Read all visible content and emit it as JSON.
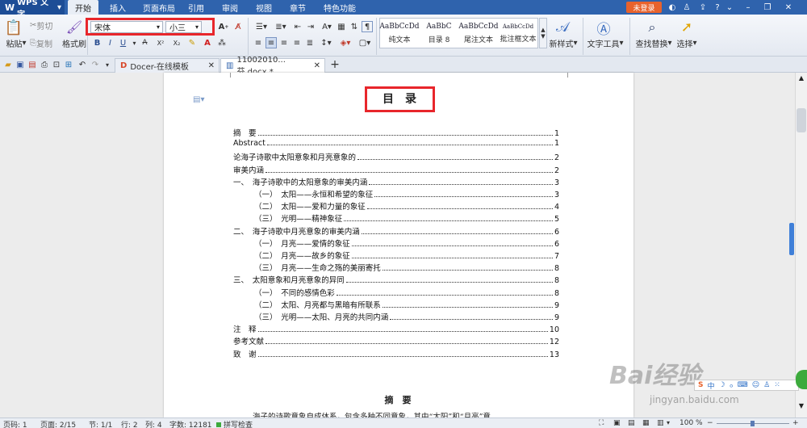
{
  "app": {
    "name": "WPS 文字"
  },
  "menu": {
    "tabs": [
      "开始",
      "插入",
      "页面布局",
      "引用",
      "审阅",
      "视图",
      "章节",
      "特色功能"
    ],
    "login_label": "未登录",
    "active_tab": "开始"
  },
  "ribbon": {
    "paste_label": "粘贴",
    "cut_label": "剪切",
    "copy_label": "复制",
    "format_painter_label": "格式刷",
    "font_name": "宋体",
    "font_size": "小三",
    "styles": [
      {
        "sample": "AaBbCcDd",
        "label": "纯文本"
      },
      {
        "sample": "AaBbC",
        "label": "目录 8"
      },
      {
        "sample": "AaBbCcDd",
        "label": "尾注文本"
      },
      {
        "sample": "AaBbCcDd",
        "label": "批注框文本"
      }
    ],
    "new_style_label": "新样式",
    "text_tools_label": "文字工具",
    "find_replace_label": "查找替换",
    "select_label": "选择"
  },
  "tabs": {
    "docer": "Docer-在线模板",
    "document": "11002010...芬.docx *",
    "add": "+"
  },
  "document": {
    "title": "目　录",
    "toc": [
      {
        "text": "摘　要",
        "page": "1",
        "indent": 0
      },
      {
        "text": "Abstract",
        "page": "1",
        "indent": 0
      },
      {
        "text": "论海子诗歌中太阳意象和月亮意象的",
        "page": "2",
        "indent": 0
      },
      {
        "text": "审美内涵",
        "page": "2",
        "indent": 0
      },
      {
        "text": "一、　海子诗歌中的太阳意象的审美内涵",
        "page": "3",
        "indent": 0
      },
      {
        "text": "（一）　太阳——永恒和希望的象征",
        "page": "3",
        "indent": 1
      },
      {
        "text": "（二）　太阳——爱和力量的象征",
        "page": "4",
        "indent": 1
      },
      {
        "text": "（三）　光明——精神象征",
        "page": "5",
        "indent": 1
      },
      {
        "text": "二、　海子诗歌中月亮意象的审美内涵",
        "page": "6",
        "indent": 0
      },
      {
        "text": "（一）　月亮——爱情的象征",
        "page": "6",
        "indent": 1
      },
      {
        "text": "（二）　月亮——故乡的象征",
        "page": "7",
        "indent": 1
      },
      {
        "text": "（三）　月亮——生命之殇的美丽寄托",
        "page": "8",
        "indent": 1
      },
      {
        "text": "三、　太阳意象和月亮意象的异同",
        "page": "8",
        "indent": 0
      },
      {
        "text": "（一）　不同的感情色彩",
        "page": "8",
        "indent": 1
      },
      {
        "text": "（二）　太阳、月亮都与黑暗有所联系",
        "page": "9",
        "indent": 1
      },
      {
        "text": "（三）　光明——太阳、月亮的共同内涵",
        "page": "9",
        "indent": 1
      },
      {
        "text": "注　释",
        "page": "10",
        "indent": 0
      },
      {
        "text": "参考文献",
        "page": "12",
        "indent": 0
      },
      {
        "text": "致　谢",
        "page": "13",
        "indent": 0
      }
    ],
    "abstract_heading": "摘　要",
    "abstract_line": "海子的诗歌意象自成体系，包含多种不同意象，其中“太阳”和“月亮”意"
  },
  "status": {
    "page_num": "页码: 1",
    "pages": "页面: 2/15",
    "section": "节: 1/1",
    "row": "行: 2",
    "col": "列: 4",
    "words": "字数: 12181",
    "spellcheck": "拼写检查",
    "zoom": "100 %"
  },
  "watermark": {
    "text": "Bai经验",
    "sub": "jingyan.baidu.com"
  },
  "colors": {
    "title_bar": "#2f63ad",
    "login": "#e8622c",
    "highlight_box": "#e8262b"
  }
}
